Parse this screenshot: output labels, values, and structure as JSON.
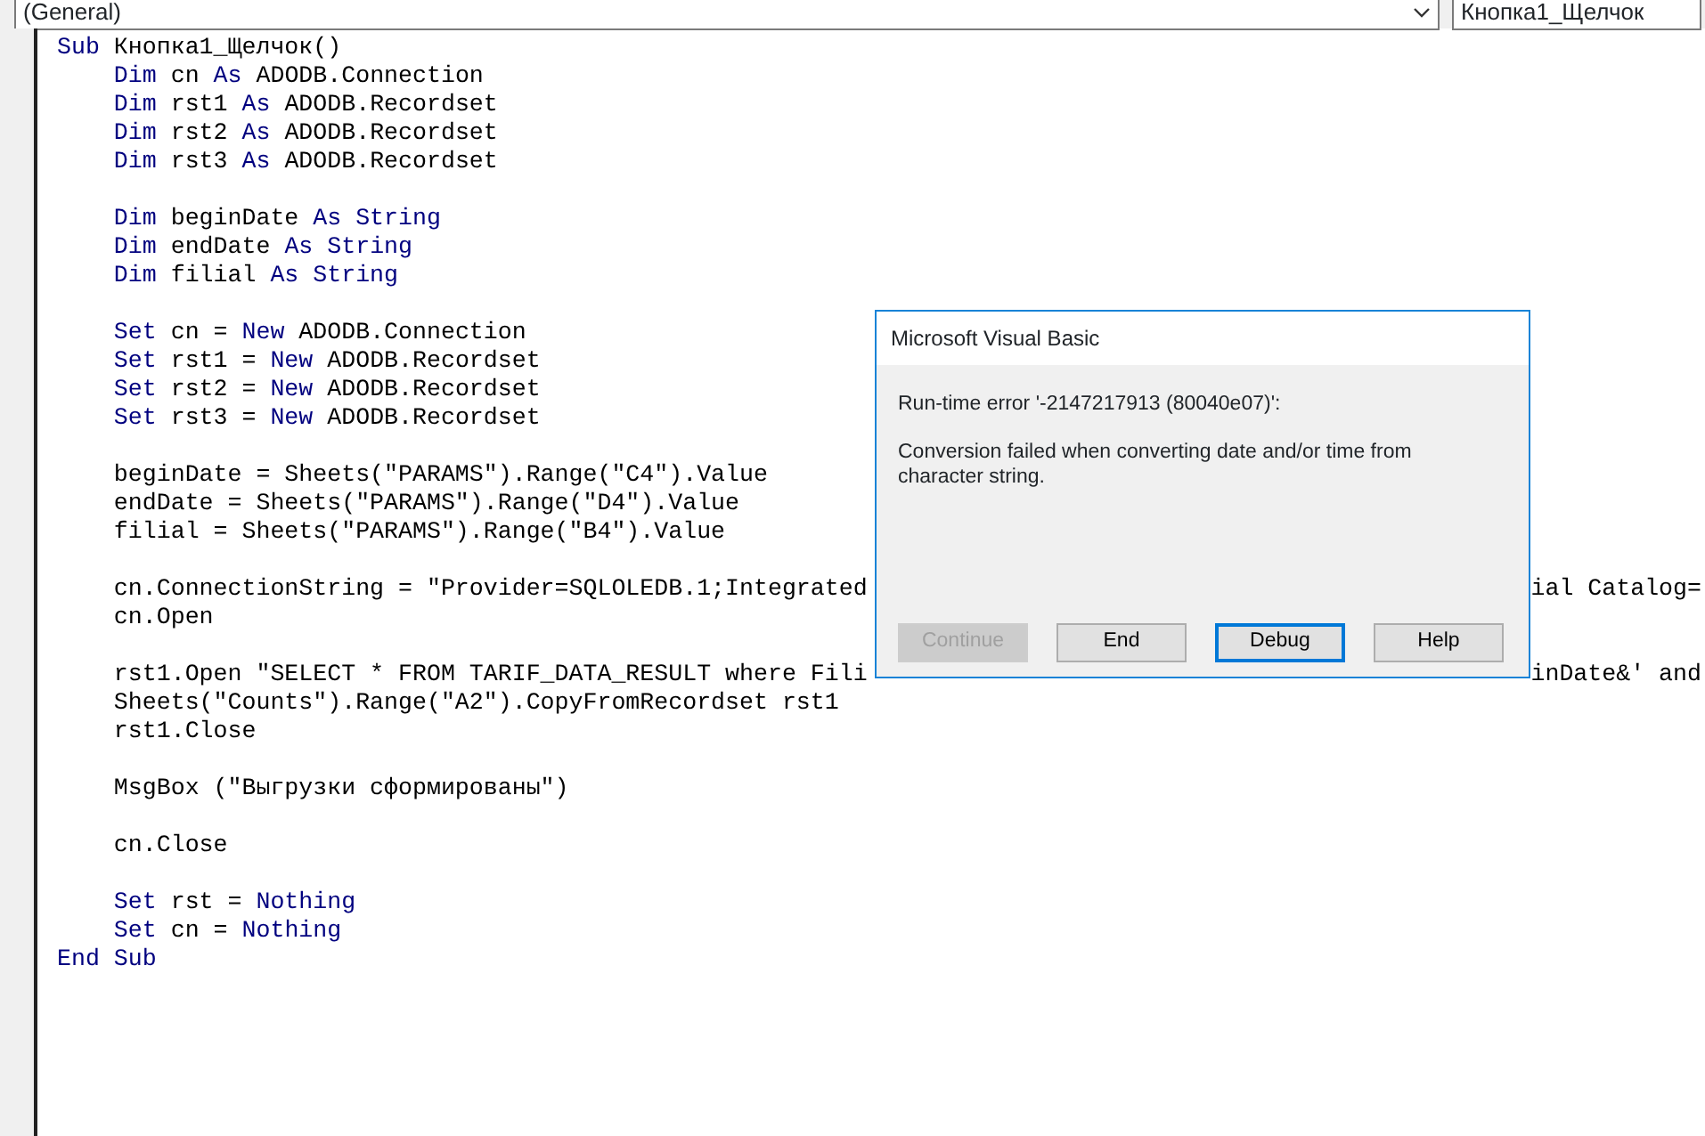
{
  "object_combo": {
    "value": "(General)"
  },
  "procedure_combo": {
    "value": "Кнопка1_Щелчок"
  },
  "code_blocks": [
    {
      "lines": [
        {
          "tokens": [
            {
              "kind": "keyword",
              "text": "Sub"
            },
            {
              "kind": "text",
              "text": " Кнопка1_Щелчок()"
            }
          ]
        },
        {
          "tokens": [
            {
              "kind": "keyword",
              "text": "    Dim"
            },
            {
              "kind": "text",
              "text": " cn "
            },
            {
              "kind": "keyword",
              "text": "As"
            },
            {
              "kind": "text",
              "text": " ADODB.Connection"
            }
          ]
        },
        {
          "tokens": [
            {
              "kind": "keyword",
              "text": "    Dim"
            },
            {
              "kind": "text",
              "text": " rst1 "
            },
            {
              "kind": "keyword",
              "text": "As"
            },
            {
              "kind": "text",
              "text": " ADODB.Recordset"
            }
          ]
        },
        {
          "tokens": [
            {
              "kind": "keyword",
              "text": "    Dim"
            },
            {
              "kind": "text",
              "text": " rst2 "
            },
            {
              "kind": "keyword",
              "text": "As"
            },
            {
              "kind": "text",
              "text": " ADODB.Recordset"
            }
          ]
        },
        {
          "tokens": [
            {
              "kind": "keyword",
              "text": "    Dim"
            },
            {
              "kind": "text",
              "text": " rst3 "
            },
            {
              "kind": "keyword",
              "text": "As"
            },
            {
              "kind": "text",
              "text": " ADODB.Recordset"
            }
          ]
        }
      ]
    },
    {
      "lines": [
        {
          "tokens": [
            {
              "kind": "keyword",
              "text": "    Dim"
            },
            {
              "kind": "text",
              "text": " beginDate "
            },
            {
              "kind": "keyword",
              "text": "As String"
            }
          ]
        },
        {
          "tokens": [
            {
              "kind": "keyword",
              "text": "    Dim"
            },
            {
              "kind": "text",
              "text": " endDate "
            },
            {
              "kind": "keyword",
              "text": "As String"
            }
          ]
        },
        {
          "tokens": [
            {
              "kind": "keyword",
              "text": "    Dim"
            },
            {
              "kind": "text",
              "text": " filial "
            },
            {
              "kind": "keyword",
              "text": "As String"
            }
          ]
        }
      ]
    },
    {
      "lines": [
        {
          "tokens": [
            {
              "kind": "keyword",
              "text": "    Set"
            },
            {
              "kind": "text",
              "text": " cn = "
            },
            {
              "kind": "keyword",
              "text": "New"
            },
            {
              "kind": "text",
              "text": " ADODB.Connection"
            }
          ]
        },
        {
          "tokens": [
            {
              "kind": "keyword",
              "text": "    Set"
            },
            {
              "kind": "text",
              "text": " rst1 = "
            },
            {
              "kind": "keyword",
              "text": "New"
            },
            {
              "kind": "text",
              "text": " ADODB.Recordset"
            }
          ]
        },
        {
          "tokens": [
            {
              "kind": "keyword",
              "text": "    Set"
            },
            {
              "kind": "text",
              "text": " rst2 = "
            },
            {
              "kind": "keyword",
              "text": "New"
            },
            {
              "kind": "text",
              "text": " ADODB.Recordset"
            }
          ]
        },
        {
          "tokens": [
            {
              "kind": "keyword",
              "text": "    Set"
            },
            {
              "kind": "text",
              "text": " rst3 = "
            },
            {
              "kind": "keyword",
              "text": "New"
            },
            {
              "kind": "text",
              "text": " ADODB.Recordset"
            }
          ]
        }
      ]
    },
    {
      "lines": [
        {
          "tokens": [
            {
              "kind": "text",
              "text": "    beginDate = Sheets(\"PARAMS\").Range(\"C4\").Value"
            }
          ]
        },
        {
          "tokens": [
            {
              "kind": "text",
              "text": "    endDate = Sheets(\"PARAMS\").Range(\"D4\").Value"
            }
          ]
        },
        {
          "tokens": [
            {
              "kind": "text",
              "text": "    filial = Sheets(\"PARAMS\").Range(\"B4\").Value"
            }
          ]
        }
      ]
    },
    {
      "lines": [
        {
          "tokens": [
            {
              "kind": "text",
              "text": "    cn.ConnectionString = \"Provider=SQLOLEDB.1;Integrated"
            }
          ],
          "tail": "ial Catalog="
        },
        {
          "tokens": [
            {
              "kind": "text",
              "text": "    cn.Open"
            }
          ]
        }
      ]
    },
    {
      "lines": [
        {
          "tokens": [
            {
              "kind": "text",
              "text": "    rst1.Open \"SELECT * FROM TARIF_DATA_RESULT where Fili"
            }
          ],
          "tail": "inDate&' and"
        },
        {
          "tokens": [
            {
              "kind": "text",
              "text": "    Sheets(\"Counts\").Range(\"A2\").CopyFromRecordset rst1"
            }
          ]
        },
        {
          "tokens": [
            {
              "kind": "text",
              "text": "    rst1.Close"
            }
          ]
        }
      ]
    },
    {
      "lines": [
        {
          "tokens": [
            {
              "kind": "text",
              "text": "    MsgBox (\"Выгрузки сформированы\")"
            }
          ]
        }
      ]
    },
    {
      "lines": [
        {
          "tokens": [
            {
              "kind": "text",
              "text": "    cn.Close"
            }
          ]
        }
      ]
    },
    {
      "lines": [
        {
          "tokens": [
            {
              "kind": "keyword",
              "text": "    Set"
            },
            {
              "kind": "text",
              "text": " rst = "
            },
            {
              "kind": "keyword",
              "text": "Nothing"
            }
          ]
        },
        {
          "tokens": [
            {
              "kind": "keyword",
              "text": "    Set"
            },
            {
              "kind": "text",
              "text": " cn = "
            },
            {
              "kind": "keyword",
              "text": "Nothing"
            }
          ]
        },
        {
          "tokens": [
            {
              "kind": "keyword",
              "text": "End Sub"
            }
          ]
        }
      ]
    }
  ],
  "dialog": {
    "title": "Microsoft Visual Basic",
    "error": "Run-time error '-2147217913 (80040e07)':",
    "message": "Conversion failed when converting date and/or time from character string.",
    "buttons": [
      {
        "label": "Continue",
        "disabled": true,
        "selected": false
      },
      {
        "label": "End",
        "disabled": false,
        "selected": false
      },
      {
        "label": "Debug",
        "disabled": false,
        "selected": true
      },
      {
        "label": "Help",
        "disabled": false,
        "selected": false
      }
    ]
  }
}
